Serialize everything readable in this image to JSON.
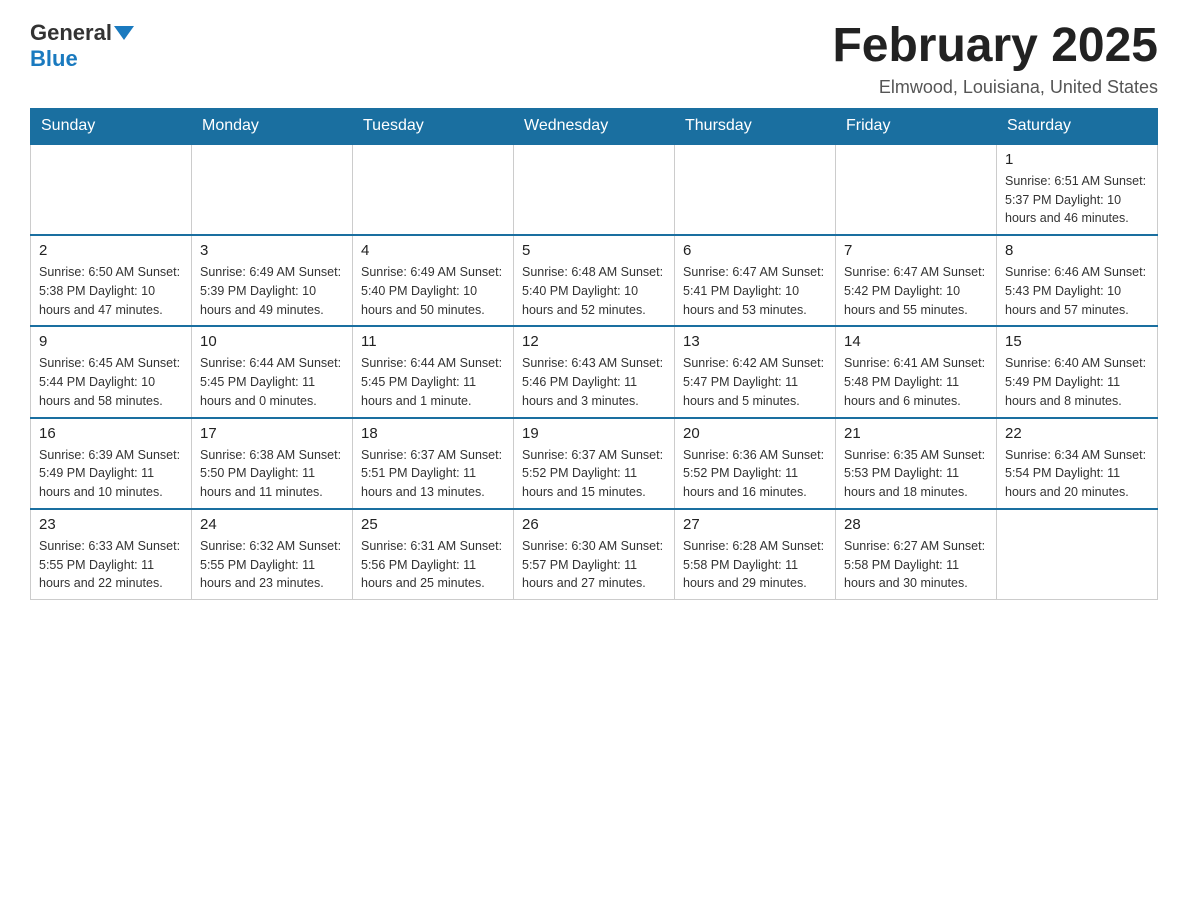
{
  "header": {
    "logo_general": "General",
    "logo_blue": "Blue",
    "month_title": "February 2025",
    "location": "Elmwood, Louisiana, United States"
  },
  "days_of_week": [
    "Sunday",
    "Monday",
    "Tuesday",
    "Wednesday",
    "Thursday",
    "Friday",
    "Saturday"
  ],
  "weeks": [
    {
      "days": [
        {
          "number": "",
          "info": ""
        },
        {
          "number": "",
          "info": ""
        },
        {
          "number": "",
          "info": ""
        },
        {
          "number": "",
          "info": ""
        },
        {
          "number": "",
          "info": ""
        },
        {
          "number": "",
          "info": ""
        },
        {
          "number": "1",
          "info": "Sunrise: 6:51 AM\nSunset: 5:37 PM\nDaylight: 10 hours and 46 minutes."
        }
      ]
    },
    {
      "days": [
        {
          "number": "2",
          "info": "Sunrise: 6:50 AM\nSunset: 5:38 PM\nDaylight: 10 hours and 47 minutes."
        },
        {
          "number": "3",
          "info": "Sunrise: 6:49 AM\nSunset: 5:39 PM\nDaylight: 10 hours and 49 minutes."
        },
        {
          "number": "4",
          "info": "Sunrise: 6:49 AM\nSunset: 5:40 PM\nDaylight: 10 hours and 50 minutes."
        },
        {
          "number": "5",
          "info": "Sunrise: 6:48 AM\nSunset: 5:40 PM\nDaylight: 10 hours and 52 minutes."
        },
        {
          "number": "6",
          "info": "Sunrise: 6:47 AM\nSunset: 5:41 PM\nDaylight: 10 hours and 53 minutes."
        },
        {
          "number": "7",
          "info": "Sunrise: 6:47 AM\nSunset: 5:42 PM\nDaylight: 10 hours and 55 minutes."
        },
        {
          "number": "8",
          "info": "Sunrise: 6:46 AM\nSunset: 5:43 PM\nDaylight: 10 hours and 57 minutes."
        }
      ]
    },
    {
      "days": [
        {
          "number": "9",
          "info": "Sunrise: 6:45 AM\nSunset: 5:44 PM\nDaylight: 10 hours and 58 minutes."
        },
        {
          "number": "10",
          "info": "Sunrise: 6:44 AM\nSunset: 5:45 PM\nDaylight: 11 hours and 0 minutes."
        },
        {
          "number": "11",
          "info": "Sunrise: 6:44 AM\nSunset: 5:45 PM\nDaylight: 11 hours and 1 minute."
        },
        {
          "number": "12",
          "info": "Sunrise: 6:43 AM\nSunset: 5:46 PM\nDaylight: 11 hours and 3 minutes."
        },
        {
          "number": "13",
          "info": "Sunrise: 6:42 AM\nSunset: 5:47 PM\nDaylight: 11 hours and 5 minutes."
        },
        {
          "number": "14",
          "info": "Sunrise: 6:41 AM\nSunset: 5:48 PM\nDaylight: 11 hours and 6 minutes."
        },
        {
          "number": "15",
          "info": "Sunrise: 6:40 AM\nSunset: 5:49 PM\nDaylight: 11 hours and 8 minutes."
        }
      ]
    },
    {
      "days": [
        {
          "number": "16",
          "info": "Sunrise: 6:39 AM\nSunset: 5:49 PM\nDaylight: 11 hours and 10 minutes."
        },
        {
          "number": "17",
          "info": "Sunrise: 6:38 AM\nSunset: 5:50 PM\nDaylight: 11 hours and 11 minutes."
        },
        {
          "number": "18",
          "info": "Sunrise: 6:37 AM\nSunset: 5:51 PM\nDaylight: 11 hours and 13 minutes."
        },
        {
          "number": "19",
          "info": "Sunrise: 6:37 AM\nSunset: 5:52 PM\nDaylight: 11 hours and 15 minutes."
        },
        {
          "number": "20",
          "info": "Sunrise: 6:36 AM\nSunset: 5:52 PM\nDaylight: 11 hours and 16 minutes."
        },
        {
          "number": "21",
          "info": "Sunrise: 6:35 AM\nSunset: 5:53 PM\nDaylight: 11 hours and 18 minutes."
        },
        {
          "number": "22",
          "info": "Sunrise: 6:34 AM\nSunset: 5:54 PM\nDaylight: 11 hours and 20 minutes."
        }
      ]
    },
    {
      "days": [
        {
          "number": "23",
          "info": "Sunrise: 6:33 AM\nSunset: 5:55 PM\nDaylight: 11 hours and 22 minutes."
        },
        {
          "number": "24",
          "info": "Sunrise: 6:32 AM\nSunset: 5:55 PM\nDaylight: 11 hours and 23 minutes."
        },
        {
          "number": "25",
          "info": "Sunrise: 6:31 AM\nSunset: 5:56 PM\nDaylight: 11 hours and 25 minutes."
        },
        {
          "number": "26",
          "info": "Sunrise: 6:30 AM\nSunset: 5:57 PM\nDaylight: 11 hours and 27 minutes."
        },
        {
          "number": "27",
          "info": "Sunrise: 6:28 AM\nSunset: 5:58 PM\nDaylight: 11 hours and 29 minutes."
        },
        {
          "number": "28",
          "info": "Sunrise: 6:27 AM\nSunset: 5:58 PM\nDaylight: 11 hours and 30 minutes."
        },
        {
          "number": "",
          "info": ""
        }
      ]
    }
  ]
}
